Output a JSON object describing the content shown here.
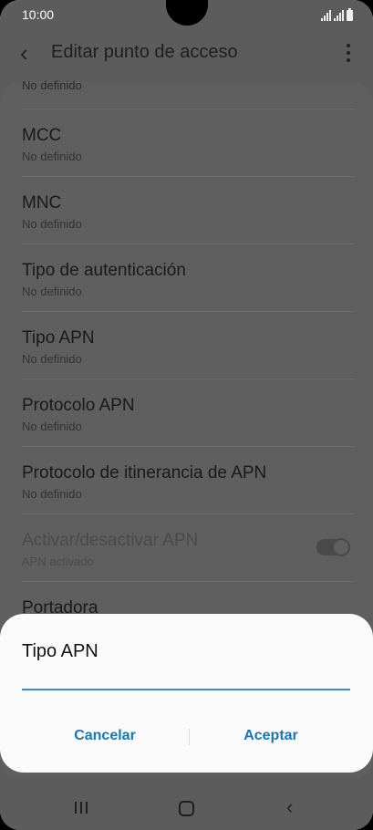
{
  "status_bar": {
    "time": "10:00"
  },
  "app_bar": {
    "title": "Editar punto de acceso"
  },
  "list": {
    "partial_item_subtitle": "No definido",
    "items": [
      {
        "label": "MCC",
        "subtitle": "No definido"
      },
      {
        "label": "MNC",
        "subtitle": "No definido"
      },
      {
        "label": "Tipo de autenticación",
        "subtitle": "No definido"
      },
      {
        "label": "Tipo APN",
        "subtitle": "No definido"
      },
      {
        "label": "Protocolo APN",
        "subtitle": "No definido"
      },
      {
        "label": "Protocolo de itinerancia de APN",
        "subtitle": "No definido"
      },
      {
        "label": "Activar/desactivar APN",
        "subtitle": "APN activado"
      },
      {
        "label": "Portadora"
      }
    ]
  },
  "dialog": {
    "title": "Tipo APN",
    "input_value": "",
    "cancel_label": "Cancelar",
    "accept_label": "Aceptar"
  }
}
